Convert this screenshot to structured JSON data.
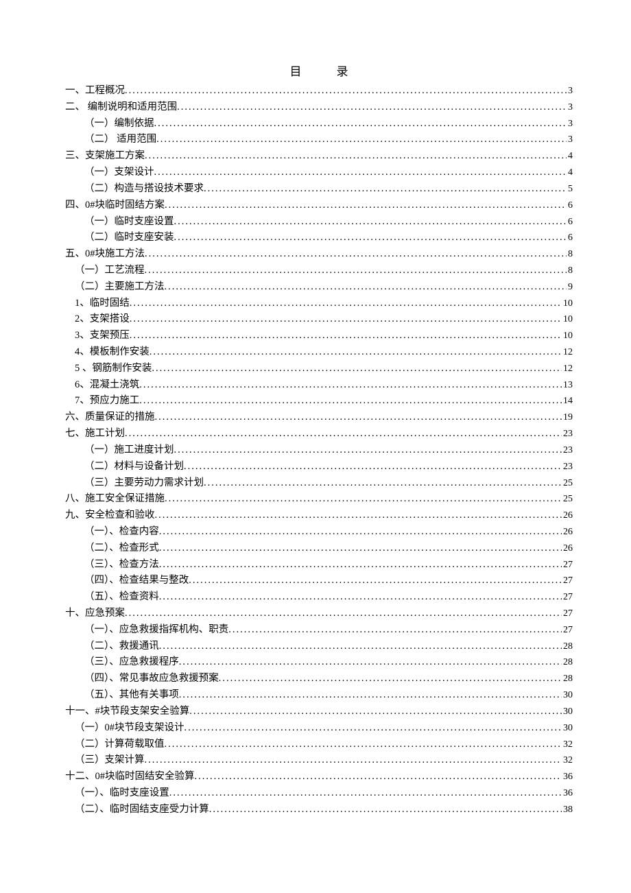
{
  "title_left": "目",
  "title_right": "录",
  "toc": [
    {
      "label": "一、工程概况",
      "page": "3",
      "indent": 0
    },
    {
      "label": "二、 编制说明和适用范围",
      "page": "3",
      "indent": 0
    },
    {
      "label": "（一）编制依据",
      "page": "3",
      "indent": 1
    },
    {
      "label": "（二） 适用范围",
      "page": "3",
      "indent": 1
    },
    {
      "label": "三、支架施工方案",
      "page": "4",
      "indent": 0
    },
    {
      "label": "（一）支架设计",
      "page": "4",
      "indent": 1
    },
    {
      "label": "（二）构造与搭设技术要求",
      "page": "5",
      "indent": 1
    },
    {
      "label": "四、0#块临时固结方案",
      "page": "6",
      "indent": 0
    },
    {
      "label": "（一）临时支座设置",
      "page": "6",
      "indent": 1
    },
    {
      "label": "（二）临时支座安装",
      "page": "6",
      "indent": 1
    },
    {
      "label": "五、0#块施工方法",
      "page": "8",
      "indent": 0
    },
    {
      "label": "（一）工艺流程",
      "page": "8",
      "indent": 2
    },
    {
      "label": "（二）主要施工方法",
      "page": "9",
      "indent": 2
    },
    {
      "label": "1、临时固结",
      "page": "10",
      "indent": 3
    },
    {
      "label": "2、支架搭设",
      "page": "10",
      "indent": 3
    },
    {
      "label": "3、支架预压",
      "page": "10",
      "indent": 3
    },
    {
      "label": "4、模板制作安装",
      "page": "12",
      "indent": 3
    },
    {
      "label": "5 、钢筋制作安装",
      "page": "12",
      "indent": 3
    },
    {
      "label": "6、混凝土浇筑",
      "page": "13",
      "indent": 3
    },
    {
      "label": "7、预应力施工",
      "page": "14",
      "indent": 3
    },
    {
      "label": "六、质量保证的措施",
      "page": "19",
      "indent": 0
    },
    {
      "label": "七、施工计划",
      "page": "23",
      "indent": 0
    },
    {
      "label": "（一）施工进度计划",
      "page": "23",
      "indent": 1
    },
    {
      "label": "（二）材料与设备计划",
      "page": "23",
      "indent": 1
    },
    {
      "label": "（三）主要劳动力需求计划",
      "page": "25",
      "indent": 1
    },
    {
      "label": "八、施工安全保证措施",
      "page": "25",
      "indent": 0
    },
    {
      "label": "九、安全检查和验收",
      "page": "26",
      "indent": 0
    },
    {
      "label": "（一）、检查内容",
      "page": "26",
      "indent": 1
    },
    {
      "label": "（二）、检查形式",
      "page": "26",
      "indent": 1
    },
    {
      "label": "（三）、检查方法",
      "page": "27",
      "indent": 1
    },
    {
      "label": "（四）、检查结果与整改",
      "page": "27",
      "indent": 1
    },
    {
      "label": "（五）、检查资料",
      "page": "27",
      "indent": 1
    },
    {
      "label": "十、应急预案",
      "page": "27",
      "indent": 0
    },
    {
      "label": "（一）、应急救援指挥机构、职责",
      "page": "27",
      "indent": 1
    },
    {
      "label": "（二）、救援通讯",
      "page": "28",
      "indent": 1
    },
    {
      "label": "（三）、应急救援程序",
      "page": "28",
      "indent": 1
    },
    {
      "label": "（四）、常见事故应急救援预案",
      "page": "28",
      "indent": 1
    },
    {
      "label": "（五）、其他有关事项",
      "page": "30",
      "indent": 1
    },
    {
      "label": "十一、#块节段支架安全验算",
      "page": "30",
      "indent": 0
    },
    {
      "label": "（一）0#块节段支架设计",
      "page": "30",
      "indent": 2
    },
    {
      "label": "（二）计算荷载取值",
      "page": "32",
      "indent": 2
    },
    {
      "label": "（三）支架计算",
      "page": "32",
      "indent": 2
    },
    {
      "label": "十二、0#块临时固结安全验算",
      "page": "36",
      "indent": 0
    },
    {
      "label": "（一）、临时支座设置",
      "page": "36",
      "indent": 2
    },
    {
      "label": "（二）、临时固结支座受力计算",
      "page": "38",
      "indent": 2
    }
  ]
}
